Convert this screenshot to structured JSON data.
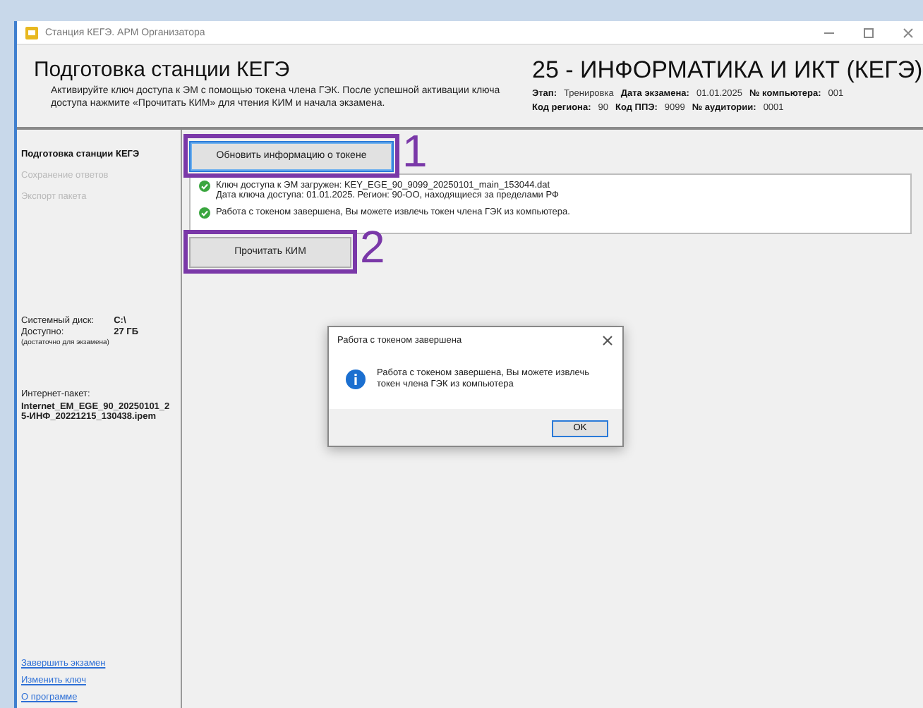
{
  "window": {
    "title": "Станция КЕГЭ. АРМ Организатора"
  },
  "header": {
    "title": "Подготовка станции КЕГЭ",
    "description": "Активируйте ключ доступа к ЭМ с помощью токена члена ГЭК. После успешной активации ключа доступа нажмите «Прочитать КИМ» для чтения КИМ и начала экзамена.",
    "subject": "25 - ИНФОРМАТИКА И ИКТ (КЕГЭ)",
    "meta_rows": [
      [
        {
          "label": "Этап:",
          "value": "Тренировка"
        },
        {
          "label": "Дата экзамена:",
          "value": "01.01.2025"
        },
        {
          "label": "№ компьютера:",
          "value": "001"
        }
      ],
      [
        {
          "label": "Код региона:",
          "value": "90"
        },
        {
          "label": "Код ППЭ:",
          "value": "9099"
        },
        {
          "label": "№ аудитории:",
          "value": "0001"
        }
      ]
    ]
  },
  "sidebar": {
    "items": [
      {
        "label": "Подготовка станции КЕГЭ",
        "selected": true,
        "disabled": false
      },
      {
        "label": "Сохранение ответов",
        "selected": false,
        "disabled": true
      },
      {
        "label": "Экспорт пакета",
        "selected": false,
        "disabled": true
      }
    ],
    "disk": {
      "label": "Системный диск:",
      "value": "C:\\",
      "free_label": "Доступно:",
      "free_value": "27 ГБ",
      "note": "(достаточно для экзамена)"
    },
    "package": {
      "label": "Интернет-пакет:",
      "value": "Internet_EM_EGE_90_20250101_25-ИНФ_20221215_130438.ipem"
    },
    "links": [
      "Завершить экзамен",
      "Изменить ключ",
      "О программе"
    ]
  },
  "content": {
    "refresh_button": {
      "label": "Обновить информацию о токене",
      "focused": true,
      "annotation": "1"
    },
    "messages": [
      {
        "kind": "success",
        "lines": [
          "Ключ доступа к ЭМ загружен: KEY_EGE_90_9099_20250101_main_153044.dat",
          "Дата ключа доступа: 01.01.2025. Регион: 90-ОО, находящиеся за пределами РФ"
        ]
      },
      {
        "kind": "success",
        "lines": [
          "Работа с токеном завершена, Вы можете извлечь токен члена ГЭК из компьютера."
        ]
      }
    ],
    "read_button": {
      "label": "Прочитать КИМ",
      "focused": false,
      "annotation": "2"
    }
  },
  "dialog": {
    "title": "Работа с токеном завершена",
    "kind": "info",
    "message": "Работа с токеном завершена, Вы можете извлечь токен члена ГЭК из компьютера",
    "ok": "OK"
  }
}
